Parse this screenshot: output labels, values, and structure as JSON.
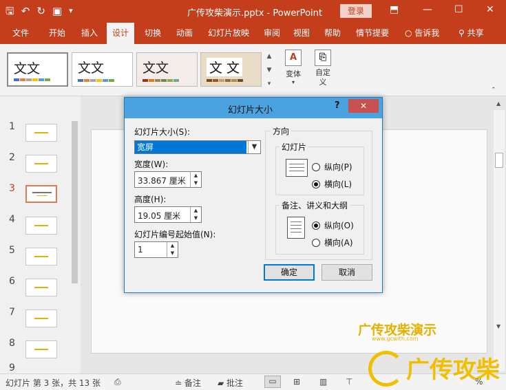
{
  "window": {
    "title": "广传攻柴演示.pptx  -  PowerPoint",
    "login": "登录"
  },
  "qat": {
    "save": "🖫",
    "undo": "↶",
    "redo": "↻",
    "present": "▣",
    "more": "▾"
  },
  "window_controls": {
    "ribbon_opts": "⬒",
    "minimize": "—",
    "maximize": "☐",
    "close": "✕"
  },
  "tabs": [
    "文件",
    "开始",
    "插入",
    "设计",
    "切换",
    "动画",
    "幻灯片放映",
    "审阅",
    "视图",
    "帮助",
    "情节提要"
  ],
  "active_tab": "设计",
  "tabs_right": {
    "tell_me": "告诉我",
    "share": "共享"
  },
  "ribbon": {
    "theme_text": "文文",
    "theme_text_a": "文文",
    "theme_text_b": "文文",
    "theme_text_c": "文 文",
    "variants_label": "变体",
    "customize_label": "自定义"
  },
  "thumbnails": {
    "numbers": [
      "1",
      "2",
      "3",
      "4",
      "5",
      "6",
      "7",
      "8",
      "9"
    ],
    "current": "3"
  },
  "dialog": {
    "title": "幻灯片大小",
    "help": "?",
    "close": "✕",
    "size_label": "幻灯片大小(S):",
    "size_value": "宽屏",
    "width_label": "宽度(W):",
    "width_value": "33.867 厘米",
    "height_label": "高度(H):",
    "height_value": "19.05 厘米",
    "start_label": "幻灯片编号起始值(N):",
    "start_value": "1",
    "orientation_label": "方向",
    "slides_group": "幻灯片",
    "slides_portrait": "纵向(P)",
    "slides_landscape": "横向(L)",
    "notes_group": "备注、讲义和大纲",
    "notes_portrait": "纵向(O)",
    "notes_landscape": "横向(A)",
    "ok": "确定",
    "cancel": "取消"
  },
  "statusbar": {
    "slide_info": "幻灯片 第 3 张，共 13 张",
    "notes": "备注",
    "comments": "批注",
    "zoom": "%"
  },
  "watermark": {
    "line1": "广传攻柴演示",
    "url": "www.gcwith.com",
    "big": "广传攻柴"
  }
}
